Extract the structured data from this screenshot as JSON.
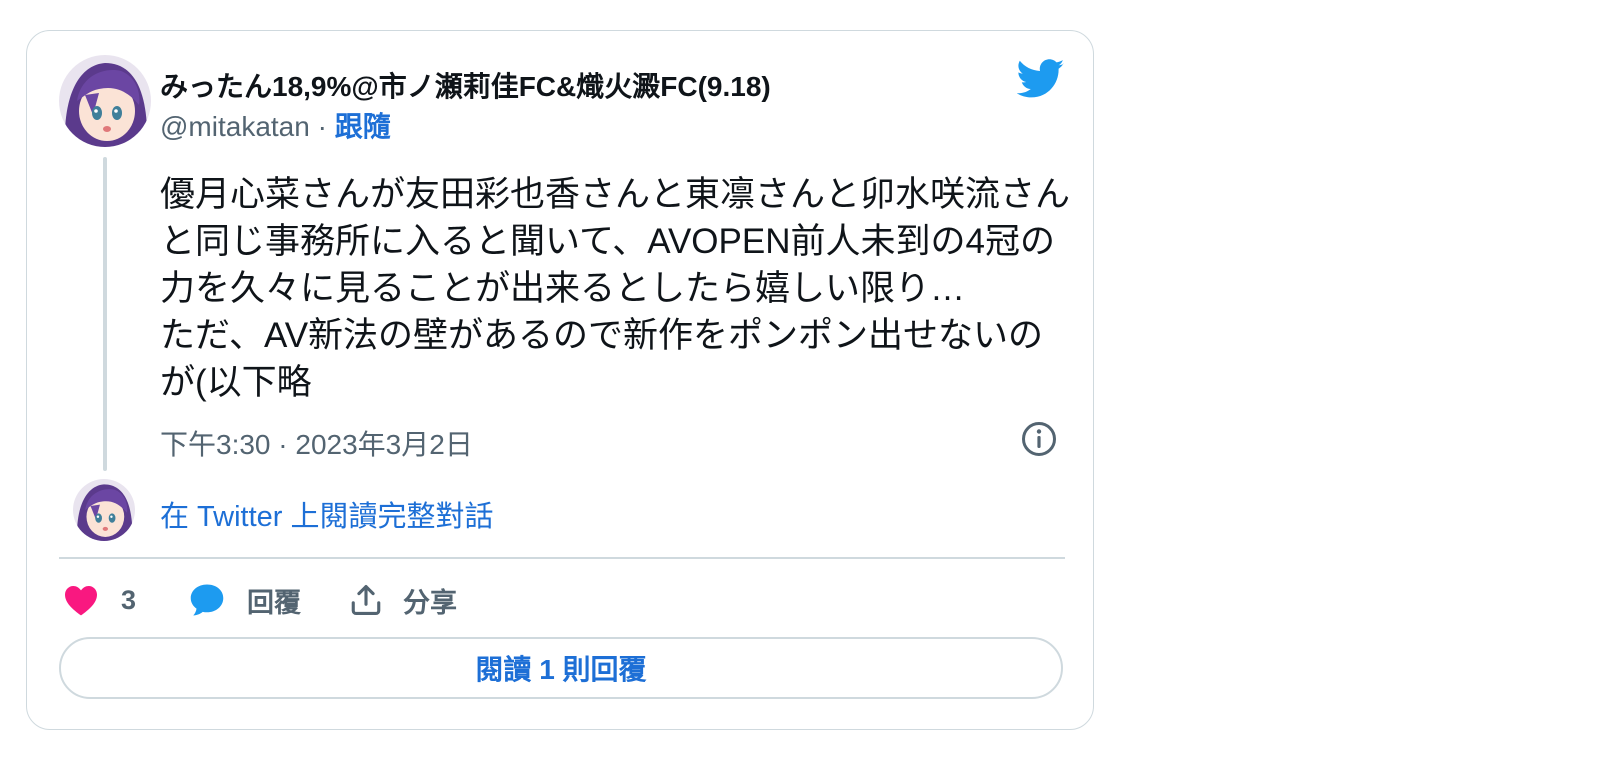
{
  "author": {
    "display_name": "みったん18,9%@市ノ瀬莉佳FC&熾火澱FC(9.18)",
    "handle": "@mitakatan",
    "separator": "·",
    "follow_label": "跟隨"
  },
  "tweet": {
    "text": "優月心菜さんが友田彩也香さんと東凛さんと卯水咲流さんと同じ事務所に入ると聞いて、AVOPEN前人未到の4冠の力を久々に見ることが出来るとしたら嬉しい限り…\nただ、AV新法の壁があるので新作をポンポン出せないのが(以下略",
    "timestamp": "下午3:30 · 2023年3月2日"
  },
  "conversation": {
    "read_label": "在 Twitter 上閱讀完整對話"
  },
  "actions": {
    "like_count": "3",
    "reply_label": "回覆",
    "share_label": "分享"
  },
  "footer": {
    "read_replies_label": "閱讀 1 則回覆"
  },
  "colors": {
    "brand": "#1d9bf0",
    "link": "#1d6fd6",
    "like": "#f91880",
    "border": "#cfd9de",
    "muted": "#536471"
  },
  "icons": [
    "twitter-bird-icon",
    "info-icon",
    "heart-icon",
    "speech-bubble-icon",
    "share-upload-icon"
  ]
}
